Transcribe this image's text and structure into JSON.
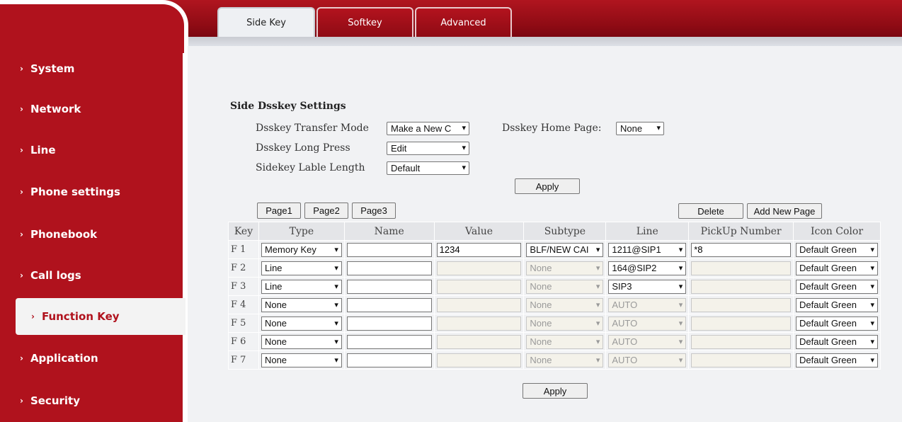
{
  "sidebar": {
    "items": [
      {
        "label": "System"
      },
      {
        "label": "Network"
      },
      {
        "label": "Line"
      },
      {
        "label": "Phone settings"
      },
      {
        "label": "Phonebook"
      },
      {
        "label": "Call logs"
      },
      {
        "label": "Function Key",
        "active": true
      },
      {
        "label": "Application"
      },
      {
        "label": "Security"
      }
    ],
    "chevron": "›"
  },
  "tabs": [
    {
      "label": "Side Key",
      "active": true
    },
    {
      "label": "Softkey"
    },
    {
      "label": "Advanced"
    }
  ],
  "settings": {
    "title": "Side Dsskey Settings",
    "transfer_mode_label": "Dsskey Transfer Mode",
    "transfer_mode_value": "Make a New C",
    "long_press_label": "Dsskey Long Press",
    "long_press_value": "Edit",
    "lable_length_label": "Sidekey Lable Length",
    "lable_length_value": "Default",
    "home_page_label": "Dsskey Home Page:",
    "home_page_value": "None",
    "apply_label": "Apply"
  },
  "pages": {
    "page1": "Page1",
    "page2": "Page2",
    "page3": "Page3",
    "delete": "Delete",
    "add_new": "Add New Page"
  },
  "table": {
    "headers": {
      "key": "Key",
      "type": "Type",
      "name": "Name",
      "value": "Value",
      "subtype": "Subtype",
      "line": "Line",
      "pickup": "PickUp Number",
      "icon_color": "Icon Color"
    },
    "rows": [
      {
        "key": "F 1",
        "type": "Memory Key",
        "name": "",
        "value": "1234",
        "subtype": "BLF/NEW CAI",
        "line": "1211@SIP1",
        "pickup": "*8",
        "icon_color": "Default Green",
        "disabled": false
      },
      {
        "key": "F 2",
        "type": "Line",
        "name": "",
        "value": "",
        "subtype": "None",
        "line": "164@SIP2",
        "pickup": "",
        "icon_color": "Default Green",
        "disabled": true,
        "line_enabled": true
      },
      {
        "key": "F 3",
        "type": "Line",
        "name": "",
        "value": "",
        "subtype": "None",
        "line": "SIP3",
        "pickup": "",
        "icon_color": "Default Green",
        "disabled": true,
        "line_enabled": true
      },
      {
        "key": "F 4",
        "type": "None",
        "name": "",
        "value": "",
        "subtype": "None",
        "line": "AUTO",
        "pickup": "",
        "icon_color": "Default Green",
        "disabled": true,
        "line_enabled": false
      },
      {
        "key": "F 5",
        "type": "None",
        "name": "",
        "value": "",
        "subtype": "None",
        "line": "AUTO",
        "pickup": "",
        "icon_color": "Default Green",
        "disabled": true,
        "line_enabled": false
      },
      {
        "key": "F 6",
        "type": "None",
        "name": "",
        "value": "",
        "subtype": "None",
        "line": "AUTO",
        "pickup": "",
        "icon_color": "Default Green",
        "disabled": true,
        "line_enabled": false
      },
      {
        "key": "F 7",
        "type": "None",
        "name": "",
        "value": "",
        "subtype": "None",
        "line": "AUTO",
        "pickup": "",
        "icon_color": "Default Green",
        "disabled": true,
        "line_enabled": false
      }
    ],
    "apply_label": "Apply"
  },
  "colors": {
    "brand_red": "#b0121d",
    "content_bg": "#f1f2f4"
  }
}
